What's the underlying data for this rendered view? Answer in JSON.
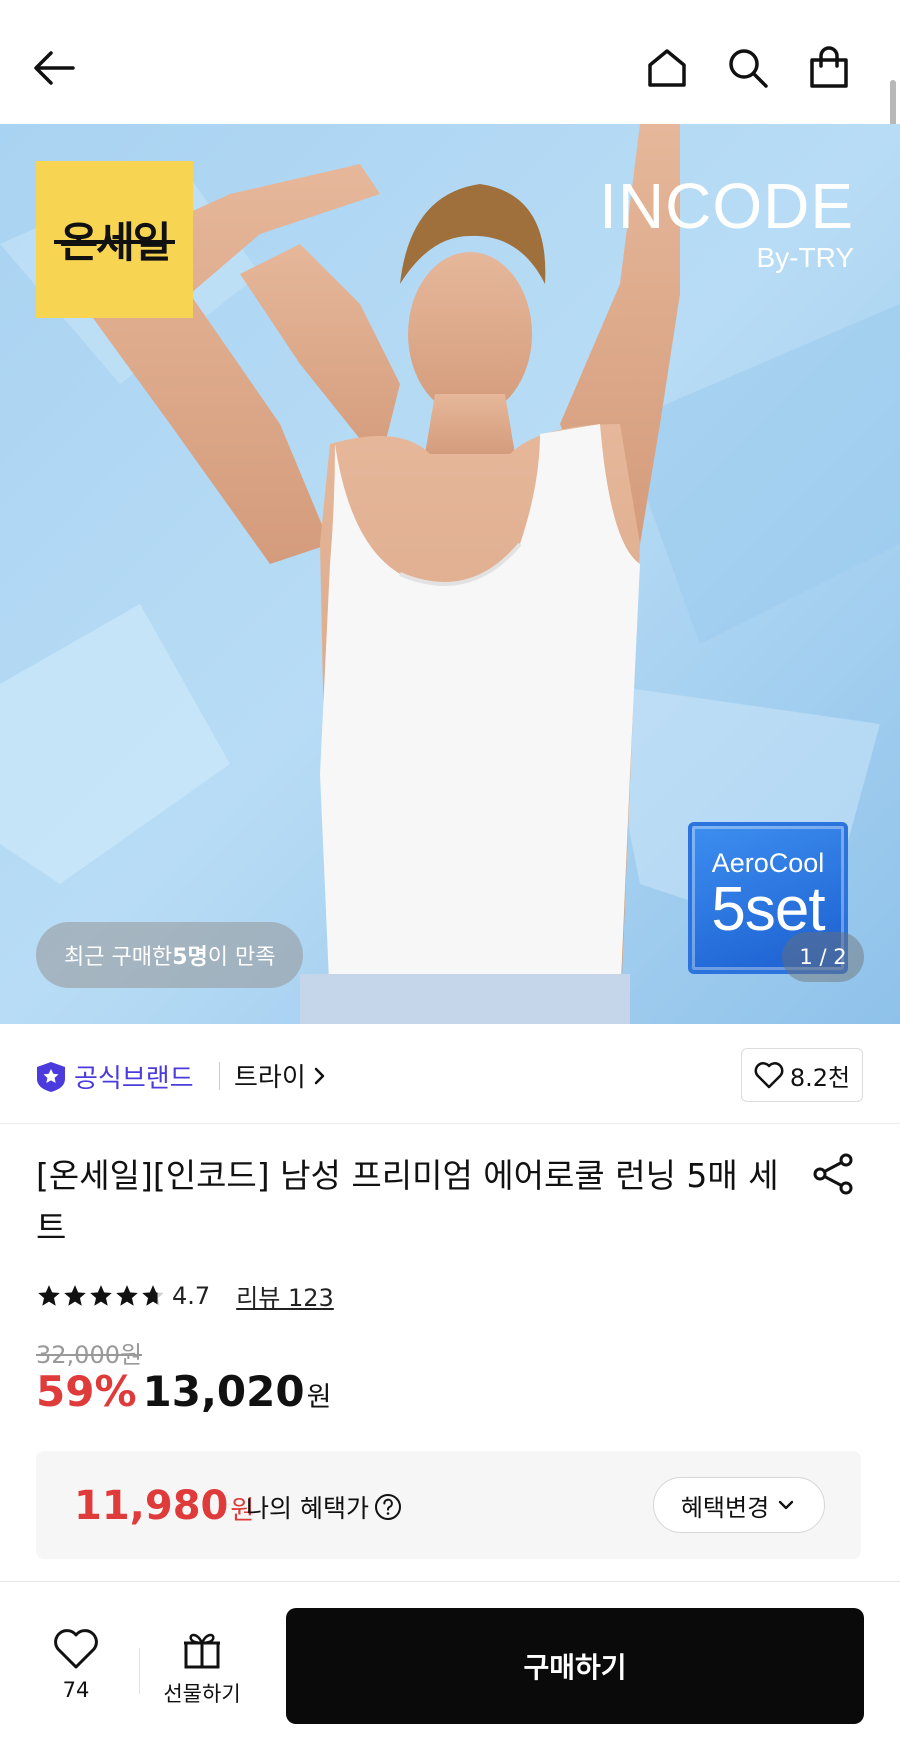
{
  "header": {
    "back_icon": "arrow-left-icon",
    "home_icon": "home-icon",
    "search_icon": "search-icon",
    "cart_icon": "shopping-bag-icon"
  },
  "gallery": {
    "sale_badge": "온세일",
    "brand_logo_line1": "INCODE",
    "brand_logo_line2": "By-TRY",
    "set_badge_line1": "AeroCool",
    "set_badge_line2": "5set",
    "satisfaction_prefix": "최근 구매한 ",
    "satisfaction_count": "5명",
    "satisfaction_suffix": "이 만족",
    "pager": "1 / 2"
  },
  "brand": {
    "official_label": "공식브랜드",
    "name": "트라이",
    "likes": "8.2천",
    "official_color": "#4b3bdc"
  },
  "product": {
    "title": "[온세일][인코드] 남성 프리미엄 에어로쿨 런닝 5매 세트",
    "rating": "4.7",
    "rating_stars": 4.7,
    "review_link": "리뷰 123",
    "original_price": "32,000원",
    "discount": "59%",
    "price": "13,020",
    "currency": "원"
  },
  "benefit": {
    "price": "11,980",
    "currency": "원",
    "label": "나의 혜택가",
    "change_button": "혜택변경",
    "accent_color": "#e03b3b"
  },
  "bottom": {
    "like_count": "74",
    "gift_label": "선물하기",
    "buy_label": "구매하기"
  }
}
